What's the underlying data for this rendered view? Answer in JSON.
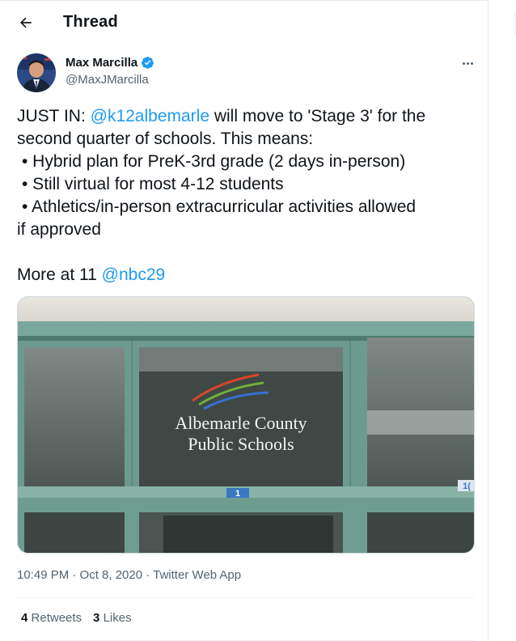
{
  "header": {
    "title": "Thread"
  },
  "author": {
    "name": "Max Marcilla",
    "handle": "@MaxJMarcilla",
    "verified": true
  },
  "tweet": {
    "line1_prefix": "JUST IN: ",
    "mention1": "@k12albemarle",
    "line1_suffix": " will move to 'Stage 3' for the second quarter of schools. This means:",
    "bullets": [
      "• Hybrid plan for PreK-3rd grade (2 days in-person)",
      "• Still virtual for most 4-12 students",
      "• Athletics/in-person extracurricular activities allowed"
    ],
    "bullet_tail": "if approved",
    "more_prefix": "More at 11 ",
    "mention2": "@nbc29"
  },
  "media": {
    "sign_line1": "Albemarle County",
    "sign_line2": "Public Schools",
    "door_number": "1",
    "door_number_partial": "1("
  },
  "meta": {
    "timestamp": "10:49 PM · Oct 8, 2020 · Twitter Web App"
  },
  "stats": {
    "retweets_count": "4",
    "retweets_label": "Retweets",
    "likes_count": "3",
    "likes_label": "Likes"
  },
  "colors": {
    "link": "#1d9bf0",
    "verified": "#1d9bf0",
    "muted": "#536471"
  }
}
